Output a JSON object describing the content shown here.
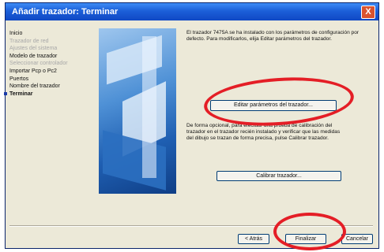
{
  "window": {
    "title": "Añadir trazador: Terminar"
  },
  "titlebar": {
    "close_glyph": "X"
  },
  "nav": {
    "items": [
      {
        "label": "Inicio",
        "state": "normal"
      },
      {
        "label": "Trazador de red",
        "state": "disabled"
      },
      {
        "label": "Ajustes del sistema",
        "state": "disabled"
      },
      {
        "label": "Modelo de trazador",
        "state": "bold"
      },
      {
        "label": "Seleccionar controlador",
        "state": "disabled"
      },
      {
        "label": "Importar Pcp o Pc2",
        "state": "normal"
      },
      {
        "label": "Puertos",
        "state": "normal"
      },
      {
        "label": "Nombre del trazador",
        "state": "normal"
      },
      {
        "label": "Terminar",
        "state": "current"
      }
    ]
  },
  "content": {
    "paragraph1": "El trazador 7475A se ha instalado con los parámetros de configuración por defecto. Para modificarlos, elija Editar parámetros del trazador.",
    "edit_button": "Editar parámetros del trazador...",
    "paragraph2": "De forma opcional, para efectuar una prueba de calibración del trazador en el trazador recién instalado y verificar que las medidas del dibujo se trazan de forma precisa, pulse Calibrar trazador.",
    "calibrate_button": "Calibrar trazador..."
  },
  "footer": {
    "back_button": "< Atrás",
    "finish_button": "Finalizar",
    "cancel_button": "Cancelar"
  },
  "colors": {
    "annotation_ring": "#e41e26",
    "titlebar": "#1c5fd8"
  }
}
